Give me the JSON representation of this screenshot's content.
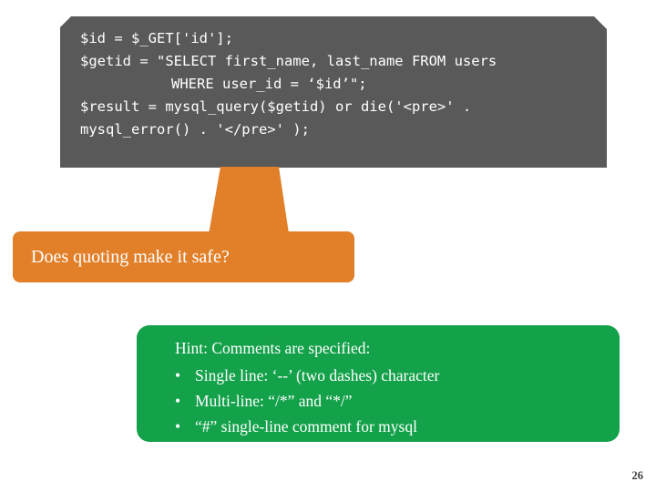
{
  "slide": {
    "number": "26"
  },
  "code_callout": {
    "name": "php-sql-code-block",
    "background_color": "#595959",
    "text_color": "#ffffff",
    "lines": [
      {
        "text": "$id = $_GET['id'];",
        "indented": false
      },
      {
        "text": "$getid = \"SELECT first_name, last_name FROM users",
        "indented": false
      },
      {
        "text": "WHERE user_id = ‘$id’\";",
        "indented": true
      },
      {
        "text": "$result = mysql_query($getid) or die('<pre>' .",
        "indented": false
      },
      {
        "text": "mysql_error() . '</pre>' );",
        "indented": false
      }
    ]
  },
  "question_bubble": {
    "text": "Does quoting make it safe?",
    "color": "#E2802A"
  },
  "hint_bubble": {
    "color": "#13A14A",
    "title": "Hint: Comments are specified:",
    "items": [
      {
        "bullet": "•",
        "text": "Single line: ‘--’ (two dashes) character"
      },
      {
        "bullet": "•",
        "text": "Multi-line: “/*” and “*/”"
      },
      {
        "bullet": "•",
        "text": "“#” single-line comment for mysql"
      }
    ]
  }
}
